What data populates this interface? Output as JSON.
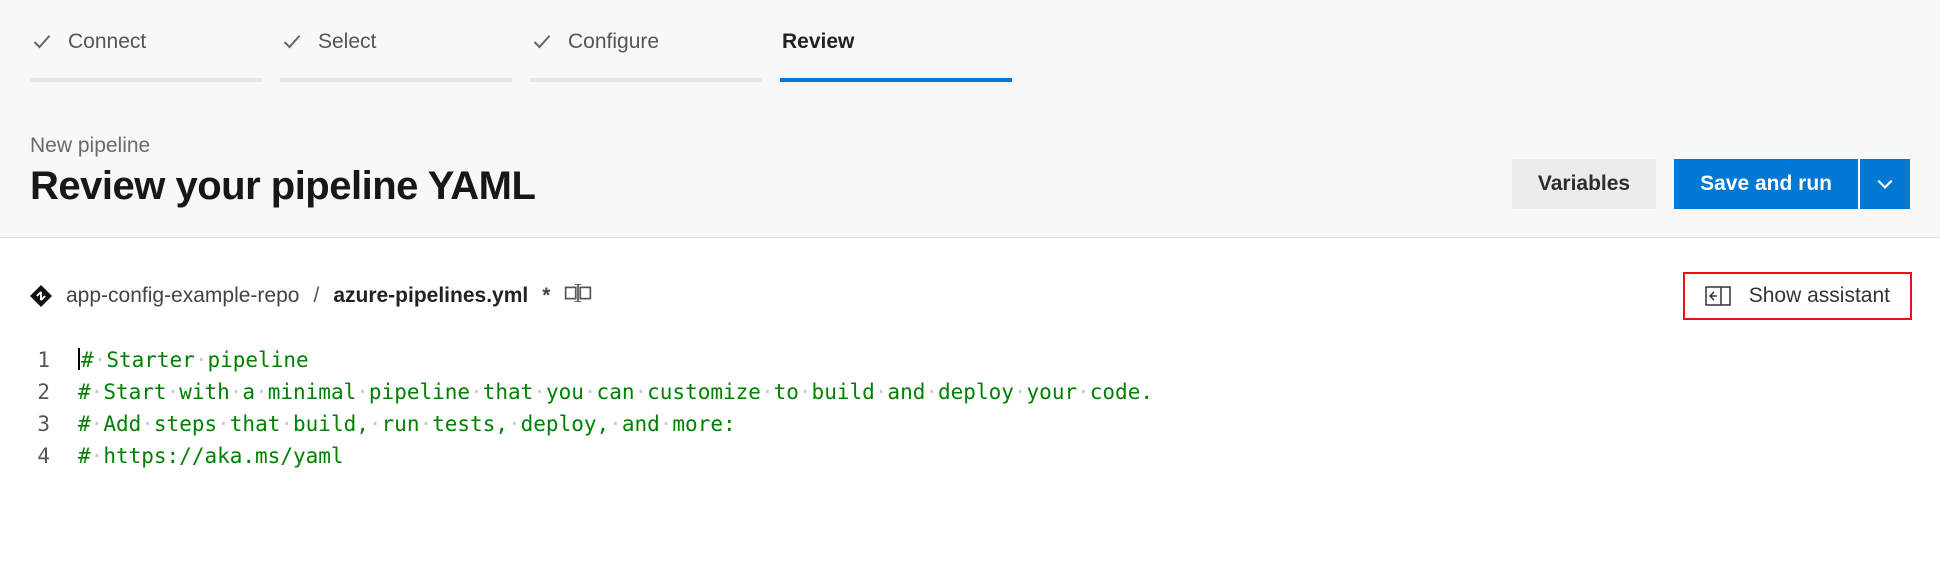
{
  "wizard": {
    "steps": [
      {
        "label": "Connect",
        "state": "completed"
      },
      {
        "label": "Select",
        "state": "completed"
      },
      {
        "label": "Configure",
        "state": "completed"
      },
      {
        "label": "Review",
        "state": "active"
      }
    ]
  },
  "header": {
    "subtitle": "New pipeline",
    "title": "Review your pipeline YAML",
    "variables_label": "Variables",
    "save_run_label": "Save and run"
  },
  "breadcrumb": {
    "repo": "app-config-example-repo",
    "sep": "/",
    "file": "azure-pipelines.yml",
    "dirty_marker": "*"
  },
  "assistant": {
    "label": "Show assistant"
  },
  "editor": {
    "lines": [
      {
        "n": 1,
        "text_tokens": [
          "#",
          "Starter",
          "pipeline"
        ]
      },
      {
        "n": 2,
        "text_tokens": [
          "#",
          "Start",
          "with",
          "a",
          "minimal",
          "pipeline",
          "that",
          "you",
          "can",
          "customize",
          "to",
          "build",
          "and",
          "deploy",
          "your",
          "code."
        ]
      },
      {
        "n": 3,
        "text_tokens": [
          "#",
          "Add",
          "steps",
          "that",
          "build,",
          "run",
          "tests,",
          "deploy,",
          "and",
          "more:"
        ]
      },
      {
        "n": 4,
        "text_tokens": [
          "#",
          "https://aka.ms/yaml"
        ]
      }
    ]
  }
}
